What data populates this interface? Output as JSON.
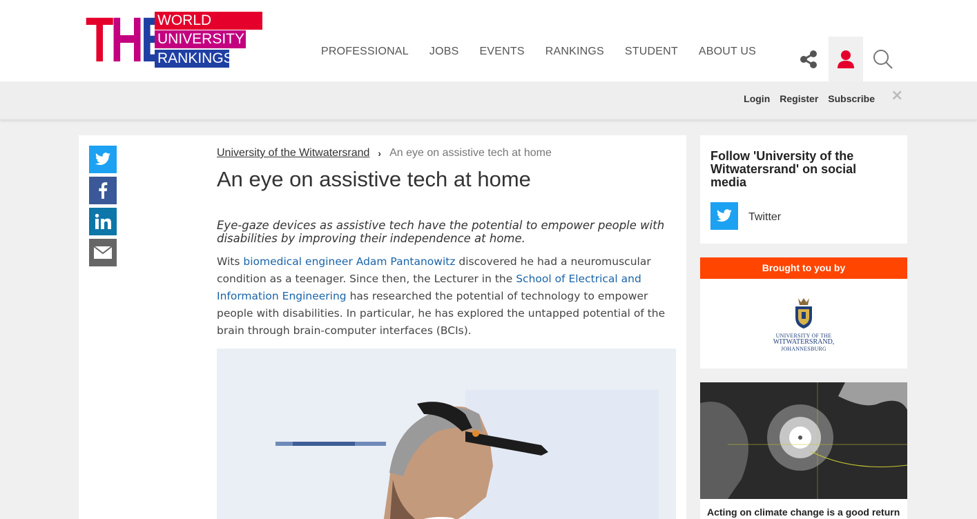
{
  "header": {
    "logo": {
      "letters": "THE",
      "line1": "WORLD",
      "line2": "UNIVERSITY",
      "line3": "RANKINGS"
    },
    "nav": [
      "PROFESSIONAL",
      "JOBS",
      "EVENTS",
      "RANKINGS",
      "STUDENT",
      "ABOUT US"
    ],
    "icons": [
      "share-icon",
      "user-icon",
      "search-icon"
    ]
  },
  "account": {
    "login": "Login",
    "register": "Register",
    "subscribe": "Subscribe",
    "close": "×"
  },
  "article": {
    "breadcrumb": {
      "parent": "University of the Witwatersrand",
      "current": "An eye on assistive tech at home"
    },
    "title": "An eye on assistive tech at home",
    "standfirst": "Eye-gaze devices as assistive tech have the potential to empower people with disabilities by improving their independence at home.",
    "body": {
      "p1": "Wits ",
      "link1": "biomedical engineer Adam Pantanowitz",
      "p2": " discovered he had a neuromuscular condition as a teenager. Since then, the Lecturer in the ",
      "link2": "School of Electrical and Information Engineering",
      "p3": " has researched the potential of technology to empower people with disabilities. In particular, he has explored the untapped potential of the brain through brain-computer interfaces (BCIs)."
    },
    "share": [
      "twitter",
      "facebook",
      "linkedin",
      "email"
    ]
  },
  "sidebar": {
    "follow_title": "Follow 'University of the Witwatersrand' on social media",
    "twitter_label": "Twitter",
    "sponsor_bar": "Brought to you by",
    "sponsor": {
      "line1": "UNIVERSITY OF THE",
      "line2": "WITWATERSRAND,",
      "line3": "JOHANNESBURG"
    },
    "promo_caption": "Acting on climate change is a good return"
  },
  "colors": {
    "brand_red": "#e4002b",
    "brand_magenta": "#c3007f",
    "brand_blue": "#1f3fa3",
    "sponsor_orange": "#ff4500",
    "link": "#1a64a8",
    "user_icon": "#e4002b"
  }
}
